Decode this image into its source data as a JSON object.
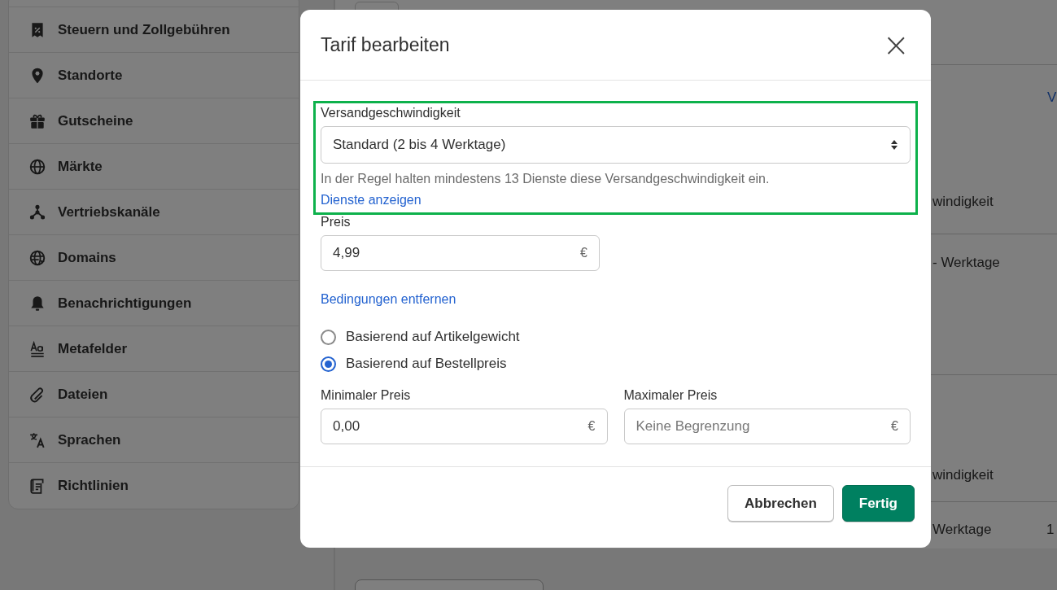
{
  "sidebar": {
    "items": [
      {
        "label": "Steuern und Zollgebühren"
      },
      {
        "label": "Standorte"
      },
      {
        "label": "Gutscheine"
      },
      {
        "label": "Märkte"
      },
      {
        "label": "Vertriebskanäle"
      },
      {
        "label": "Domains"
      },
      {
        "label": "Benachrichtigungen"
      },
      {
        "label": "Metafelder"
      },
      {
        "label": "Dateien"
      },
      {
        "label": "Sprachen"
      },
      {
        "label": "Richtlinien"
      }
    ]
  },
  "background": {
    "link": "V",
    "rows": [
      {
        "text": "windigkeit"
      },
      {
        "text": "- Werktage"
      },
      {
        "text": "windigkeit"
      },
      {
        "text": "Werktage",
        "extra": "1"
      }
    ]
  },
  "dialog": {
    "title": "Tarif bearbeiten",
    "close": "×",
    "speed": {
      "highlighted": true,
      "label": "Versandgeschwindigkeit",
      "value": "Standard (2 bis 4 Werktage)",
      "help": "In der Regel halten mindestens 13 Dienste diese Versandgeschwindigkeit ein.",
      "link": "Dienste anzeigen"
    },
    "price": {
      "label": "Preis",
      "value": "4,99",
      "suffix": "€"
    },
    "remove_link": "Bedingungen entfernen",
    "options": [
      {
        "label": "Basierend auf Artikelgewicht",
        "selected": false
      },
      {
        "label": "Basierend auf Bestellpreis",
        "selected": true
      }
    ],
    "min": {
      "label": "Minimaler Preis",
      "value": "0,00",
      "suffix": "€"
    },
    "max": {
      "label": "Maximaler Preis",
      "placeholder": "Keine Begrenzung",
      "suffix": "€"
    },
    "buttons": [
      {
        "label": "Abbrechen",
        "kind": "secondary"
      },
      {
        "label": "Fertig",
        "kind": "primary"
      }
    ]
  }
}
